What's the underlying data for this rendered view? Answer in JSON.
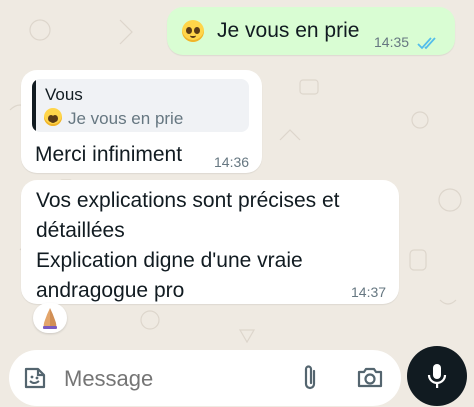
{
  "colors": {
    "outgoing_bubble": "#d9fdd3",
    "incoming_bubble": "#ffffff",
    "chat_background": "#efeae2",
    "read_ticks": "#53bdeb",
    "mic_button": "#111b21"
  },
  "messages": [
    {
      "direction": "outgoing",
      "emoji": "pleading-face",
      "text": "Je vous en prie",
      "time": "14:35",
      "status": "read"
    },
    {
      "direction": "incoming",
      "reply_to": {
        "sender": "Vous",
        "emoji": "pleading-face",
        "text": "Je vous en prie"
      },
      "text": "Merci infiniment",
      "time": "14:36"
    },
    {
      "direction": "incoming",
      "lines": [
        "Vos explications sont précises et",
        "détaillées",
        "Explication digne d'une vraie",
        "andragogue pro"
      ],
      "time": "14:37",
      "reaction": "folded-hands"
    }
  ],
  "composer": {
    "placeholder": "Message",
    "icons": [
      "sticker-icon",
      "attach-icon",
      "camera-icon",
      "mic-icon"
    ]
  }
}
